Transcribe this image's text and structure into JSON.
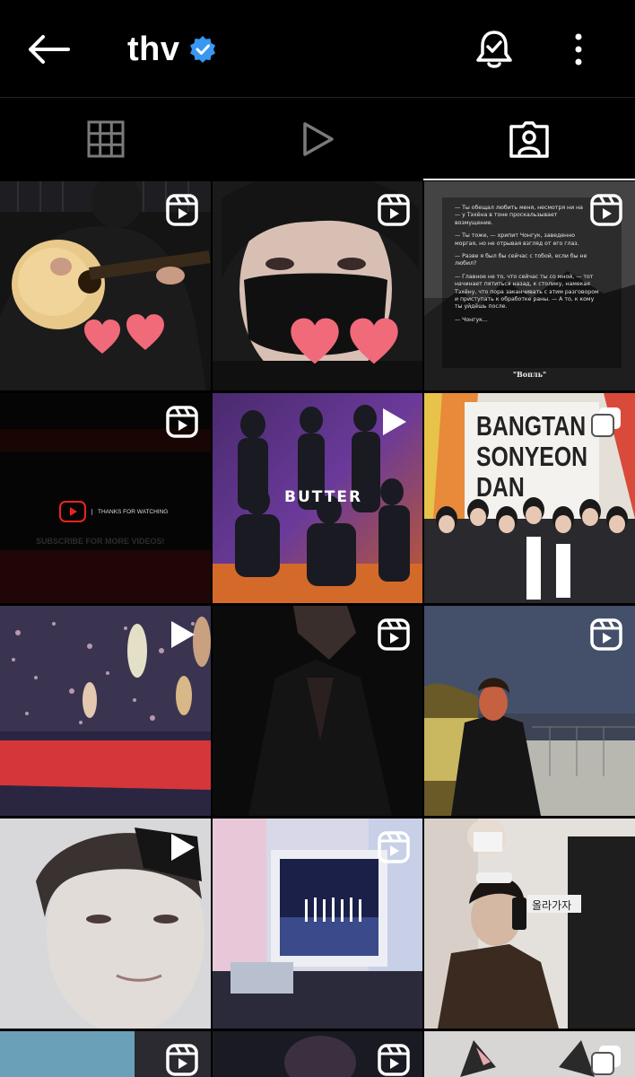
{
  "header": {
    "title": "thv",
    "verified": true
  },
  "icons": {
    "back": "arrow-left-icon",
    "verified": "verified-badge-icon",
    "bell": "notification-bell-check-icon",
    "more": "more-vertical-icon",
    "grid_tab": "grid-icon",
    "reels_tab": "play-icon",
    "tagged_tab": "tagged-person-icon",
    "reel_badge": "reels-icon",
    "play_badge": "play-icon",
    "carousel_badge": "carousel-icon"
  },
  "tabs": [
    {
      "name": "posts-grid",
      "active": false
    },
    {
      "name": "reels",
      "active": false
    },
    {
      "name": "tagged",
      "active": true
    }
  ],
  "colors": {
    "background": "#000000",
    "verified_blue": "#3897f0",
    "heart_pink": "#f06a7a"
  },
  "tiles": [
    {
      "id": 1,
      "badge": "reel",
      "hearts": 2
    },
    {
      "id": 2,
      "badge": "reel",
      "hearts": 2
    },
    {
      "id": 3,
      "badge": "reel",
      "caption_lines": [
        "— Ты обещал любить меня, несмотря ни на",
        "— у Тэхёна в тоне проскальзывает",
        "возмущение.",
        "— Ты тоже, — хрипит Чонгук, заведенно",
        "моргая, но не отрывая взгляд от его глаз.",
        "— Разве я был бы сейчас с тобой, если бы не",
        "любил?",
        "— Главное не то, что сейчас ты со мной, — тот",
        "начинает пятиться назад, к столику, намекая",
        "Тэхёну, что пора заканчивать с этим разговором",
        "и приступать к обработке раны. — А то, к кому",
        "ты уйдёшь после.",
        "— Чонгук..."
      ],
      "caption_footer": "\"Вопль\""
    },
    {
      "id": 4,
      "badge": "reel",
      "video_end_text": "THANKS FOR WATCHING",
      "video_end_sub": "SUBSCRIBE FOR MORE VIDEOS!"
    },
    {
      "id": 5,
      "badge": "play",
      "overlay_text": "BUTTER"
    },
    {
      "id": 6,
      "badge": "carousel",
      "banner_lines": [
        "BANGTAN",
        "SONYEON",
        "DAN"
      ]
    },
    {
      "id": 7,
      "badge": "play"
    },
    {
      "id": 8,
      "badge": "reel"
    },
    {
      "id": 9,
      "badge": "reel"
    },
    {
      "id": 10,
      "badge": "play"
    },
    {
      "id": 11,
      "badge": "reel"
    },
    {
      "id": 12,
      "badge": "none",
      "sign_text": "올라가자"
    },
    {
      "id": 13,
      "badge": "reel"
    },
    {
      "id": 14,
      "badge": "reel"
    },
    {
      "id": 15,
      "badge": "carousel"
    }
  ]
}
